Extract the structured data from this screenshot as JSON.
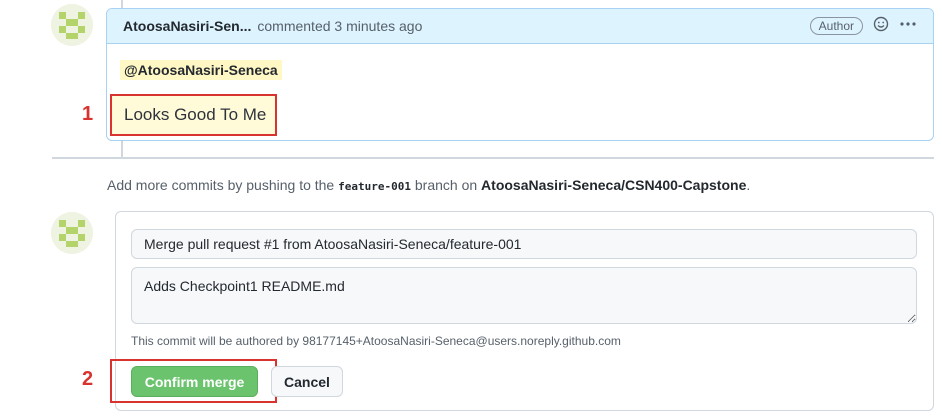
{
  "comment": {
    "author": "AtoosaNasiri-Sen...",
    "action": "commented 3 minutes ago",
    "author_badge": "Author",
    "mention": "@AtoosaNasiri-Seneca",
    "body": "Looks Good To Me"
  },
  "callouts": [
    "1",
    "2"
  ],
  "branch_info": {
    "prefix": "Add more commits by pushing to the",
    "branch": "feature-001",
    "middle": "branch on",
    "repo": "AtoosaNasiri-Seneca/CSN400-Capstone",
    "suffix": "."
  },
  "merge": {
    "title_value": "Merge pull request #1 from AtoosaNasiri-Seneca/feature-001",
    "body_value": "Adds Checkpoint1 README.md",
    "author_note": "This commit will be authored by 98177145+AtoosaNasiri-Seneca@users.noreply.github.com",
    "confirm_label": "Confirm merge",
    "cancel_label": "Cancel"
  },
  "colors": {
    "accent_green": "#6bc46d",
    "callout_red": "#d9332f",
    "header_blue": "#ddf4ff",
    "highlight_yellow": "#fff8c5"
  },
  "icons": [
    "identicon-avatar",
    "smiley-icon",
    "kebab-menu-icon"
  ]
}
